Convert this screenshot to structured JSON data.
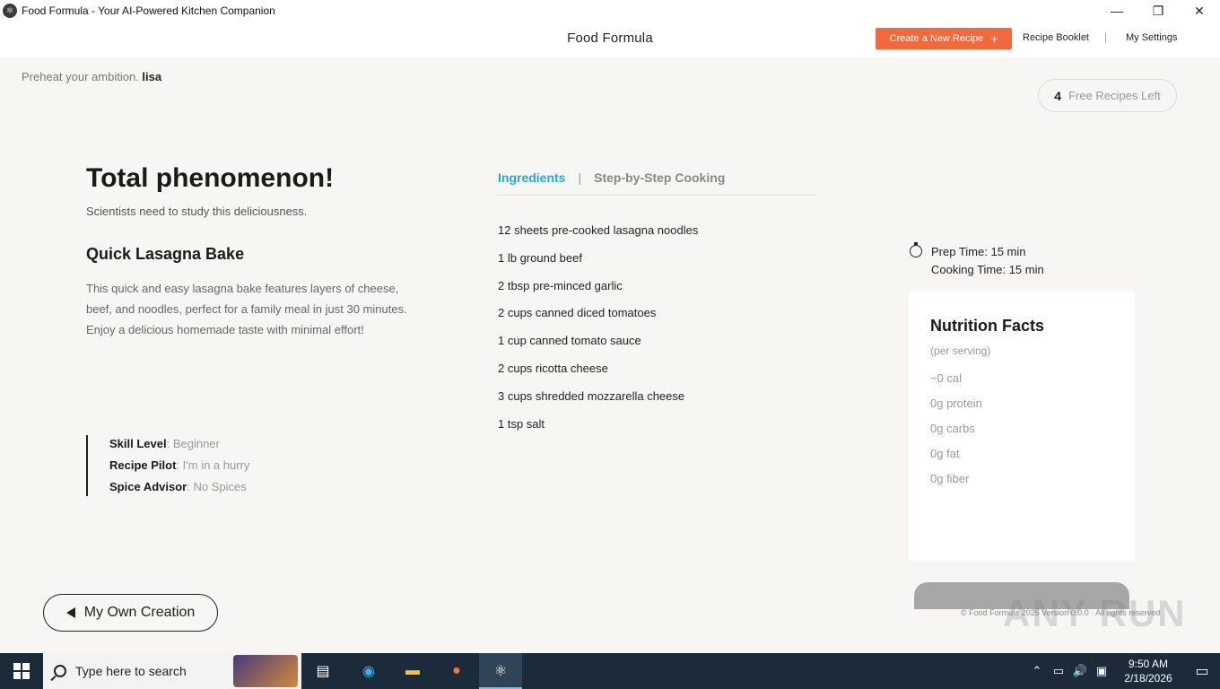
{
  "window": {
    "title": "Food Formula - Your AI-Powered Kitchen Companion",
    "minimize": "—",
    "maximize": "❐",
    "close": "✕"
  },
  "header": {
    "brand": "Food Formula",
    "create_label": "Create a New Recipe",
    "create_icon": "+",
    "recipe_booklet": "Recipe Booklet",
    "separator": "|",
    "my_settings": "My Settings"
  },
  "greeting": {
    "prefix": "Preheat your ambition.",
    "user": "lisa"
  },
  "credits": {
    "count": "4",
    "label": "Free Recipes Left"
  },
  "result": {
    "headline": "Total phenomenon!",
    "subline": "Scientists need to study this deliciousness.",
    "recipe_name": "Quick Lasagna Bake",
    "description": "This quick and easy lasagna bake features layers of cheese, beef, and noodles, perfect for a family meal in just 30 minutes. Enjoy a delicious homemade taste with minimal effort!"
  },
  "meta": [
    {
      "key": "Skill Level",
      "value": "Beginner"
    },
    {
      "key": "Recipe Pilot",
      "value": "I'm in a hurry"
    },
    {
      "key": "Spice Advisor",
      "value": "No Spices"
    }
  ],
  "tabs": {
    "ingredients": "Ingredients",
    "separator": "|",
    "steps": "Step-by-Step Cooking"
  },
  "ingredients": [
    "12 sheets pre-cooked lasagna noodles",
    "1 lb ground beef",
    "2 tbsp pre-minced garlic",
    "2 cups canned diced tomatoes",
    "1 cup canned tomato sauce",
    "2 cups ricotta cheese",
    "3 cups shredded mozzarella cheese",
    "1 tsp salt"
  ],
  "times": {
    "prep": "Prep Time: 15 min",
    "cook": "Cooking Time: 15 min"
  },
  "nutrition": {
    "title": "Nutrition Facts",
    "serving": "(per serving)",
    "facts": [
      "~0 cal",
      "0g protein",
      "0g carbs",
      "0g fat",
      "0g fiber"
    ]
  },
  "own_creation": "My Own Creation",
  "footer": "© Food Formula 2025 Version 0.0.0 · All rights reserved",
  "watermark": "ANY RUN",
  "taskbar": {
    "search_placeholder": "Type here to search",
    "time": "9:50 AM",
    "date": "2/18/2026"
  }
}
